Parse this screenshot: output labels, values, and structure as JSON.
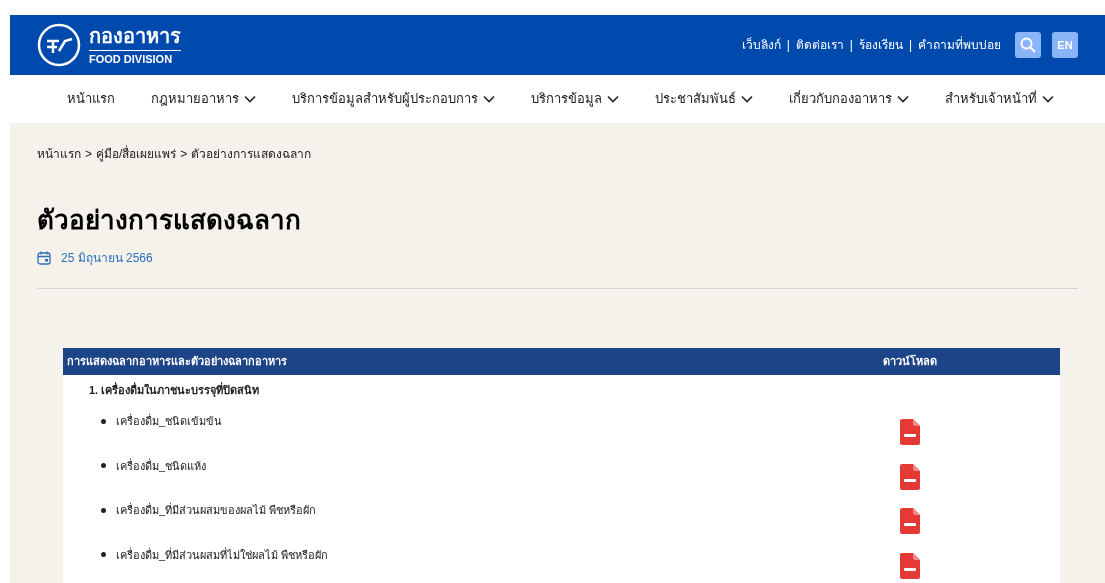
{
  "header": {
    "logo_title": "กองอาหาร",
    "logo_subtitle": "FOOD DIVISION",
    "links": [
      "เว็บลิงก์",
      "ติดต่อเรา",
      "ร้องเรียน",
      "คำถามที่พบบ่อย"
    ],
    "separator": "|",
    "language": "EN"
  },
  "nav": [
    {
      "label": "หน้าแรก",
      "has_menu": false
    },
    {
      "label": "กฎหมายอาหาร",
      "has_menu": true
    },
    {
      "label": "บริการข้อมูลสำหรับผู้ประกอบการ",
      "has_menu": true
    },
    {
      "label": "บริการข้อมูล",
      "has_menu": true
    },
    {
      "label": "ประชาสัมพันธ์",
      "has_menu": true
    },
    {
      "label": "เกี่ยวกับกองอาหาร",
      "has_menu": true
    },
    {
      "label": "สำหรับเจ้าหน้าที่",
      "has_menu": true
    }
  ],
  "breadcrumb": [
    "หน้าแรก",
    "คู่มือ/สื่อเผยแพร่",
    "ตัวอย่างการแสดงฉลาก"
  ],
  "breadcrumb_separator": ">",
  "title": "ตัวอย่างการแสดงฉลาก",
  "date": "25 มิถุนายน 2566",
  "table": {
    "columns": [
      "การแสดงฉลากอาหารและตัวอย่างฉลากอาหาร",
      "ดาวน์โหลด"
    ],
    "rows": [
      {
        "kind": "group",
        "text": "1. เครื่องดื่มในภาชนะบรรจุที่ปิดสนิท"
      },
      {
        "kind": "item",
        "text": "เครื่องดื่ม_ชนิดเข้มข้น"
      },
      {
        "kind": "item",
        "text": "เครื่องดื่ม_ชนิดแห้ง"
      },
      {
        "kind": "item",
        "text": "เครื่องดื่ม_ที่มีส่วนผสมของผลไม้ พืชหรือผัก"
      },
      {
        "kind": "item",
        "text": "เครื่องดื่ม_ที่มีส่วนผสมที่ไม่ใช่ผลไม้ พืชหรือผัก"
      }
    ]
  }
}
